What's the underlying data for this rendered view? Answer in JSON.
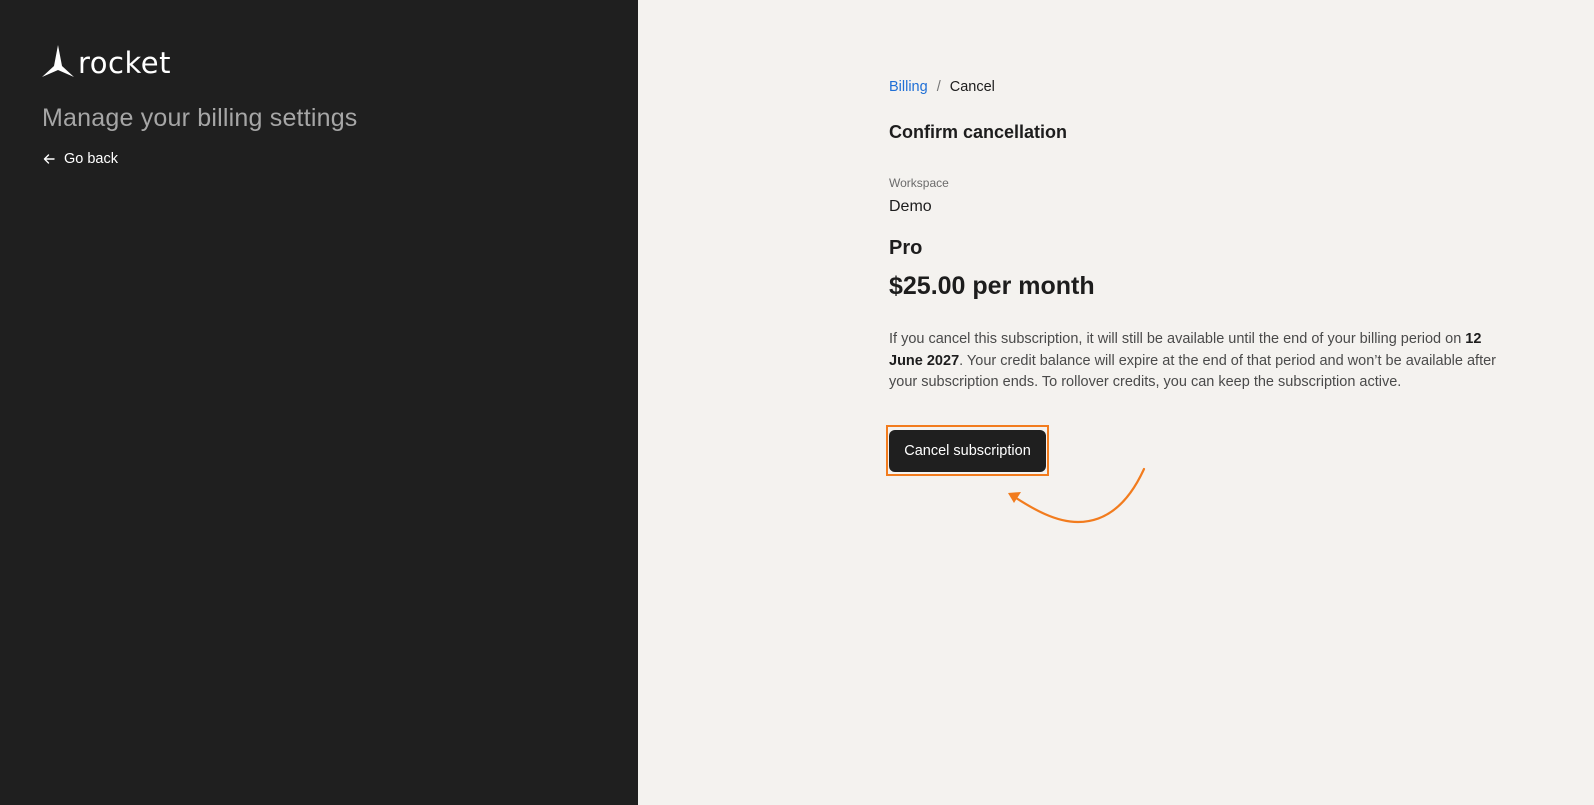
{
  "brand": {
    "name": "rocket",
    "logo_icon": "rocket-logo-icon"
  },
  "sidebar": {
    "title": "Manage your billing settings",
    "go_back_label": "Go back",
    "go_back_icon": "arrow-left-icon"
  },
  "breadcrumb": {
    "items": [
      "Billing",
      "Cancel"
    ],
    "separator": "/"
  },
  "main": {
    "heading": "Confirm cancellation",
    "workspace_label": "Workspace",
    "workspace_value": "Demo",
    "plan_name": "Pro",
    "plan_price": "$25.00 per month",
    "notice_part1": "If you cancel this subscription, it will still be available until the end of your billing period on ",
    "notice_date": "12 June 2027",
    "notice_part2": ". Your credit balance will expire at the end of that period and won’t be available after your subscription ends. To rollover credits, you can keep the subscription active.",
    "cancel_button_label": "Cancel subscription"
  },
  "annotation": {
    "highlight_color": "#f27c1e",
    "arrow_icon": "curved-arrow-annotation-icon"
  },
  "colors": {
    "sidebar_bg": "#1f1f1f",
    "main_bg": "#f4f2ef",
    "link": "#1f6fd6",
    "button_bg": "#1f1f1f"
  }
}
